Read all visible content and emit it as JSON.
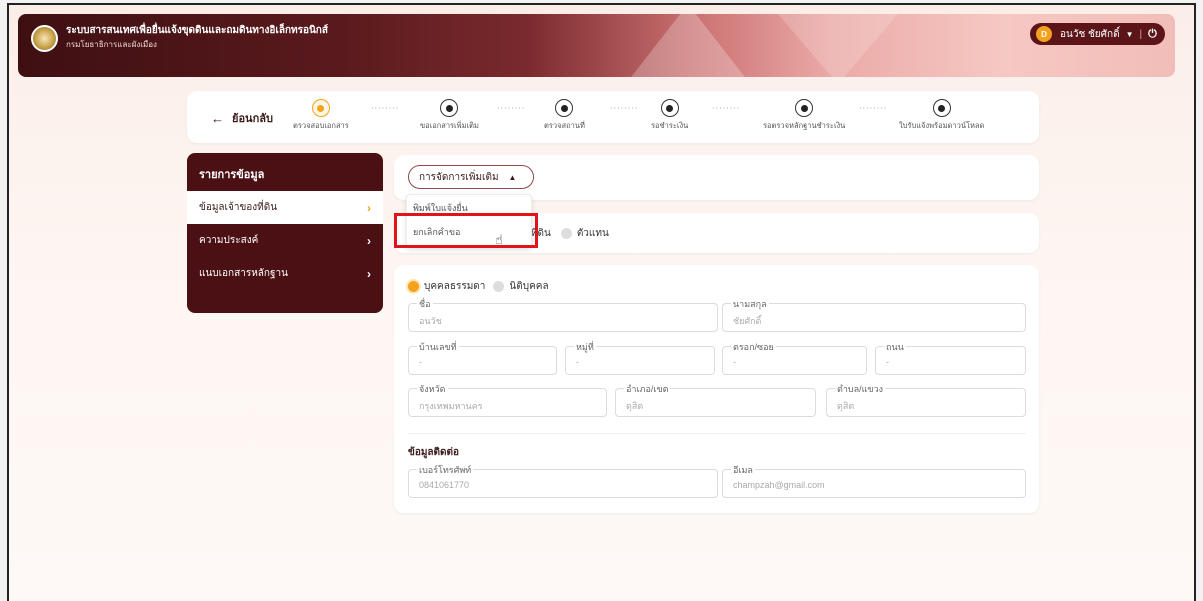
{
  "header": {
    "title": "ระบบสารสนเทศเพื่อยื่นแจ้งขุดดินและถมดินทางอิเล็กทรอนิกส์",
    "subtitle": "กรมโยธาธิการและผังเมือง",
    "user": {
      "initial": "D",
      "name": "อนวัช ชัยศักดิ์"
    }
  },
  "stepper": {
    "back_label": "ย้อนกลับ",
    "steps": [
      {
        "label": "ตรวจสอบเอกสาร",
        "active": true
      },
      {
        "label": "ขอเอกสารเพิ่มเติม",
        "active": false
      },
      {
        "label": "ตรวจสถานที่",
        "active": false
      },
      {
        "label": "รอชำระเงิน",
        "active": false
      },
      {
        "label": "รอตรวจหลักฐานชำระเงิน",
        "active": false
      },
      {
        "label": "ใบรับแจ้งพร้อมดาวน์โหลด",
        "active": false
      }
    ]
  },
  "sidebar": {
    "title": "รายการข้อมูล",
    "items": [
      {
        "label": "ข้อมูลเจ้าของที่ดิน",
        "active": true
      },
      {
        "label": "ความประสงค์",
        "active": false
      },
      {
        "label": "แนบเอกสารหลักฐาน",
        "active": false
      }
    ]
  },
  "actions": {
    "manage_label": "การจัดการเพิ่มเติม",
    "menu": [
      "พิมพ์ใบแจ้งยื่น",
      "ยกเลิกคำขอ"
    ]
  },
  "owner_type": {
    "visible_text": "งที่ดิน",
    "agent_label": "ตัวแทน"
  },
  "form": {
    "person_types": [
      {
        "label": "บุคคลธรรมดา",
        "selected": true
      },
      {
        "label": "นิติบุคคล",
        "selected": false
      }
    ],
    "fields": {
      "first_name": {
        "label": "ชื่อ",
        "value": "อนวัช"
      },
      "last_name": {
        "label": "นามสกุล",
        "value": "ชัยศักดิ์"
      },
      "house_no": {
        "label": "บ้านเลขที่",
        "value": "-"
      },
      "moo": {
        "label": "หมู่ที่",
        "value": "-"
      },
      "soi": {
        "label": "ตรอก/ซอย",
        "value": "-"
      },
      "road": {
        "label": "ถนน",
        "value": "-"
      },
      "province": {
        "label": "จังหวัด",
        "value": "กรุงเทพมหานคร"
      },
      "district": {
        "label": "อำเภอ/เขต",
        "value": "ดุสิต"
      },
      "subdistrict": {
        "label": "ตำบล/แขวง",
        "value": "ดุสิต"
      }
    },
    "contact": {
      "title": "ข้อมูลติดต่อ",
      "phone": {
        "label": "เบอร์โทรศัพท์",
        "value": "0841061770"
      },
      "email": {
        "label": "อีเมล",
        "value": "champzah@gmail.com"
      }
    }
  },
  "colors": {
    "brand": "#4a1014",
    "accent": "#f4a21d",
    "highlight": "#e0141b"
  }
}
